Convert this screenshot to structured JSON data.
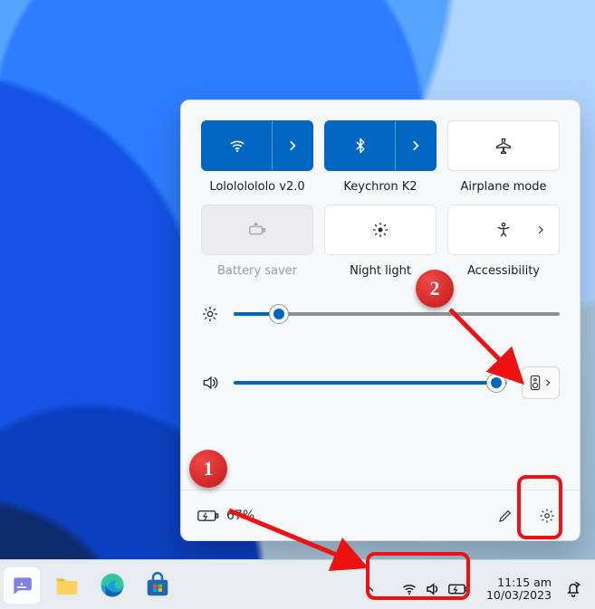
{
  "colors": {
    "accent": "#0067c0",
    "annotation_red": "#e11111"
  },
  "quick_settings": {
    "tiles": [
      {
        "id": "wifi",
        "label": "Lolololololo v2.0",
        "state": "on",
        "split": true,
        "icon": "wifi-icon"
      },
      {
        "id": "bluetooth",
        "label": "Keychron K2",
        "state": "on",
        "split": true,
        "icon": "bluetooth-icon"
      },
      {
        "id": "airplane",
        "label": "Airplane mode",
        "state": "off",
        "split": false,
        "icon": "airplane-icon"
      },
      {
        "id": "battery_saver",
        "label": "Battery saver",
        "state": "disabled",
        "split": false,
        "icon": "battery-saver-icon"
      },
      {
        "id": "night_light",
        "label": "Night light",
        "state": "off",
        "split": false,
        "icon": "night-light-icon"
      },
      {
        "id": "accessibility",
        "label": "Accessibility",
        "state": "off",
        "split": false,
        "has_chevron": true,
        "icon": "accessibility-icon"
      }
    ],
    "brightness": {
      "percent": 14
    },
    "volume": {
      "percent": 96
    },
    "battery": {
      "percent_text": "67%",
      "charging": true
    },
    "output_device_button": "Sound output"
  },
  "taskbar": {
    "apps": [
      {
        "id": "chat",
        "icon": "chat-icon"
      },
      {
        "id": "explorer",
        "icon": "folder-icon"
      },
      {
        "id": "edge",
        "icon": "edge-icon"
      },
      {
        "id": "store",
        "icon": "store-icon"
      }
    ],
    "tray": {
      "overflow": "^",
      "status_icons": [
        "wifi",
        "volume",
        "battery"
      ],
      "time": "11:15 am",
      "date": "10/03/2023"
    }
  },
  "annotations": {
    "badge1": "1",
    "badge2": "2"
  }
}
